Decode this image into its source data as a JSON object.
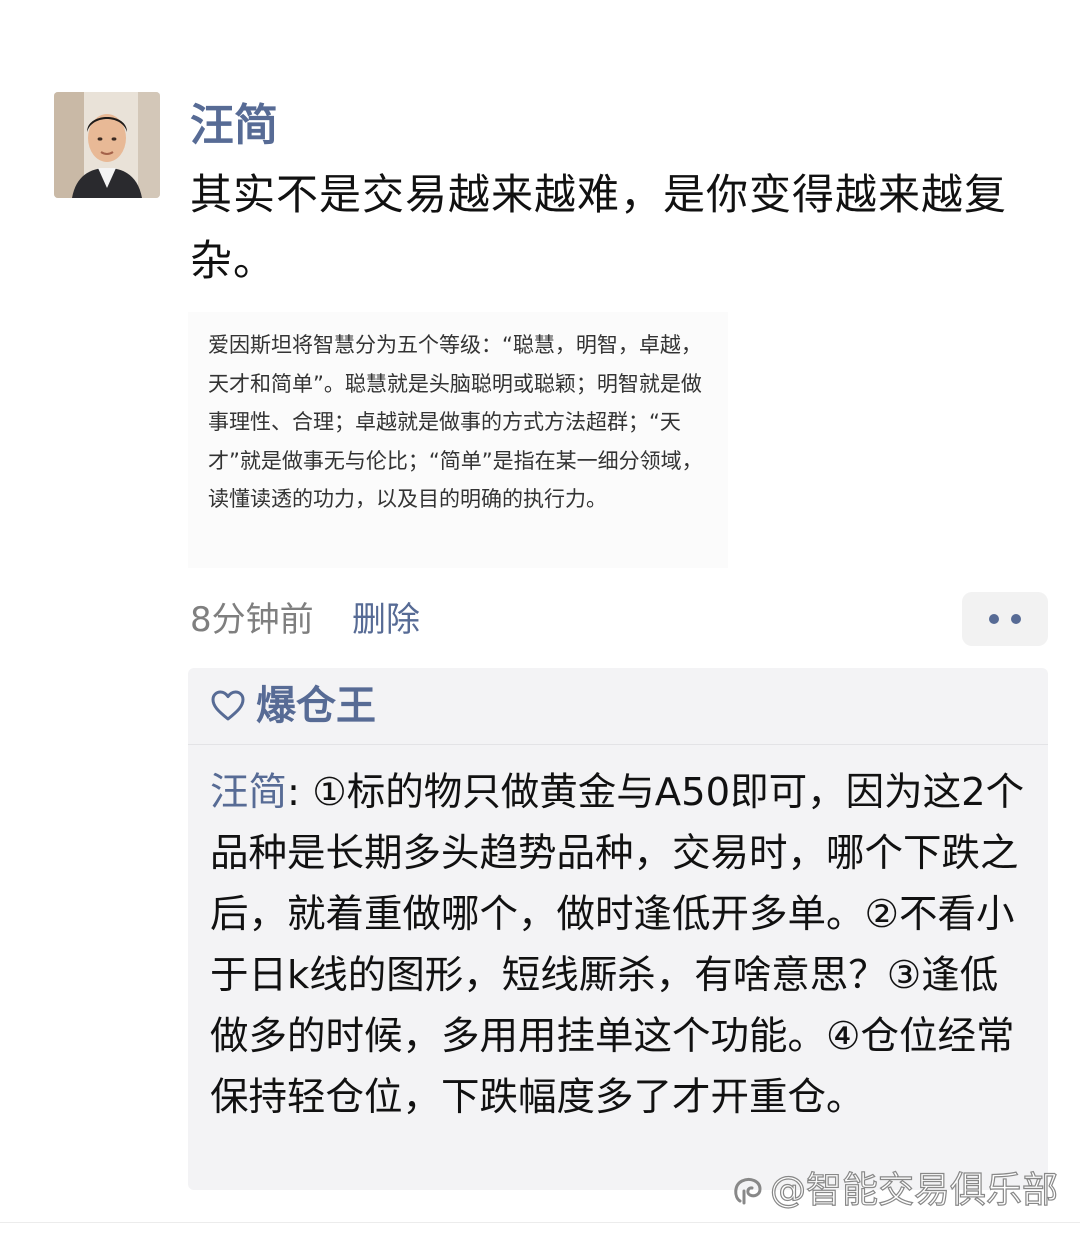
{
  "post": {
    "author": "汪简",
    "text": "其实不是交易越来越难，是你变得越来越复杂。",
    "image_text": "爱因斯坦将智慧分为五个等级：“聪慧，明智，卓越，天才和简单”。聪慧就是头脑聪明或聪颖；明智就是做事理性、合理；卓越就是做事的方式方法超群；“天才”就是做事无与伦比；“简单”是指在某一细分领域，读懂读透的功力，以及目的明确的执行力。",
    "time": "8分钟前",
    "delete_label": "删除"
  },
  "likes": {
    "icon": "heart-icon",
    "names": "爆仓王"
  },
  "comment": {
    "author": "汪简",
    "separator": ": ",
    "text": "①标的物只做黄金与A50即可，因为这2个品种是长期多头趋势品种，交易时，哪个下跌之后，就着重做哪个，做时逢低开多单。②不看小于日k线的图形，短线厮杀，有啥意思？③逢低做多的时候，多用用挂单这个功能。④仓位经常保持轻仓位，下跌幅度多了才开重仓。"
  },
  "watermark": {
    "text": "@智能交易俱乐部"
  },
  "colors": {
    "link": "#576b95",
    "panel": "#f3f3f5",
    "muted": "#7f7f7f"
  }
}
